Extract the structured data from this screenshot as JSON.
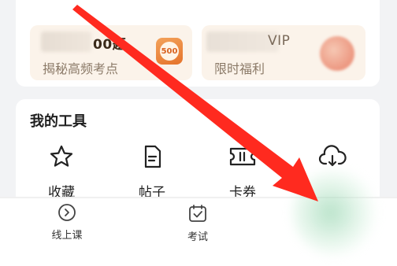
{
  "promo": {
    "left": {
      "title_visible": "00题",
      "subtitle": "揭秘高频考点",
      "badge": "500"
    },
    "right": {
      "title_visible": "VIP",
      "subtitle": "限时福利"
    }
  },
  "tools": {
    "title": "我的工具",
    "items": [
      {
        "label": "收藏",
        "icon": "star-icon"
      },
      {
        "label": "帖子",
        "icon": "document-icon"
      },
      {
        "label": "卡券",
        "icon": "ticket-icon"
      },
      {
        "label": "",
        "icon": "cloud-download-icon"
      }
    ]
  },
  "bottom_nav": {
    "items": [
      {
        "label": "线上课",
        "icon": "play-circle-icon"
      },
      {
        "label": "考试",
        "icon": "calendar-check-icon"
      }
    ]
  },
  "colors": {
    "arrow": "#ff2a1f",
    "promo_bg": "#fbf3ea",
    "badge": "#e5732b"
  }
}
